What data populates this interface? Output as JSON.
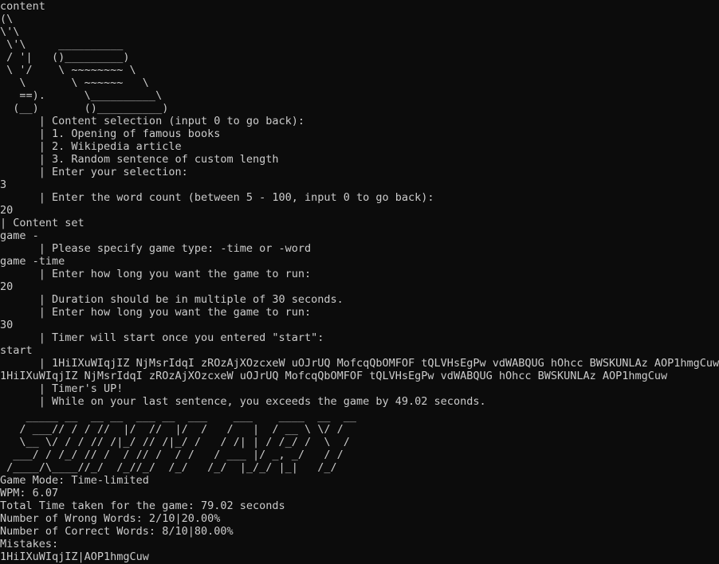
{
  "terminal": {
    "background": "#0c0c0c",
    "foreground": "#cccccc",
    "header": {
      "title_line": "content",
      "ascii_book_art": [
        "(\\",
        "\\'\\",
        " \\'\\     __________",
        " / '|   ()_________)",
        " \\ '/    \\ ~~~~~~~~ \\",
        "   \\       \\ ~~~~~~   \\",
        "   ==).      \\__________\\",
        "  (__)       ()__________)"
      ]
    },
    "content_menu": {
      "prompt": "      | Content selection (input 0 to go back):",
      "options": [
        "      | 1. Opening of famous books",
        "      | 2. Wikipedia article",
        "      | 3. Random sentence of custom length"
      ],
      "selection_prompt": "      | Enter your selection:"
    },
    "session_lines": [
      "3",
      "      | Enter the word count (between 5 - 100, input 0 to go back):",
      "20",
      "| Content set",
      "game -",
      "      | Please specify game type: -time or -word",
      "game -time",
      "      | Enter how long you want the game to run:",
      "20",
      "      | Duration should be in multiple of 30 seconds.",
      "      | Enter how long you want the game to run:",
      "30",
      "      | Timer will start once you entered \"start\":",
      "start",
      "      | 1HiIXuWIqjIZ NjMsrIdqI zROzAjXOzcxeW uOJrUQ MofcqQbOMFOF tQLVHsEgPw vdWABQUG hOhcc BWSKUNLAz AOP1hmgCuw",
      "1HiIXuWIqjIZ NjMsrIdqI zROzAjXOzcxeW uOJrUQ MofcqQbOMFOF tQLVHsEgPw vdWABQUG hOhcc BWSKUNLAz AOP1hmgCuw",
      "      | Timer's UP!",
      "      | While on your last sentence, you exceeds the game by 49.02 seconds."
    ],
    "summary_banner": [
      "    _____ __  __ __  ___ __  ___    ___    ____  __  __",
      "   / ___// / / //  |/  //  |/  /   /   |  / __ \\ \\/ /",
      "   \\__ \\/ / / // /|_/ // /|_/ /   / /| | / /_/ /  \\  /",
      "  ___/ / /_/ // /  / // /  / /   / ___ |/ _, _/   / /",
      " /____/\\____//_/  /_//_/  /_/   /_/  |_/_/ |_|   /_/"
    ],
    "results": {
      "game_mode": "Game Mode: Time-limited",
      "wpm": "WPM: 6.07",
      "total_time": "Total Time taken for the game: 79.02 seconds",
      "wrong_words": "Number of Wrong Words: 2/10|20.00%",
      "correct_words": "Number of Correct Words: 8/10|80.00%",
      "mistakes_label": "Mistakes:",
      "mistakes_value": "1HiIXuWIqjIZ|AOP1hmgCuw"
    }
  }
}
